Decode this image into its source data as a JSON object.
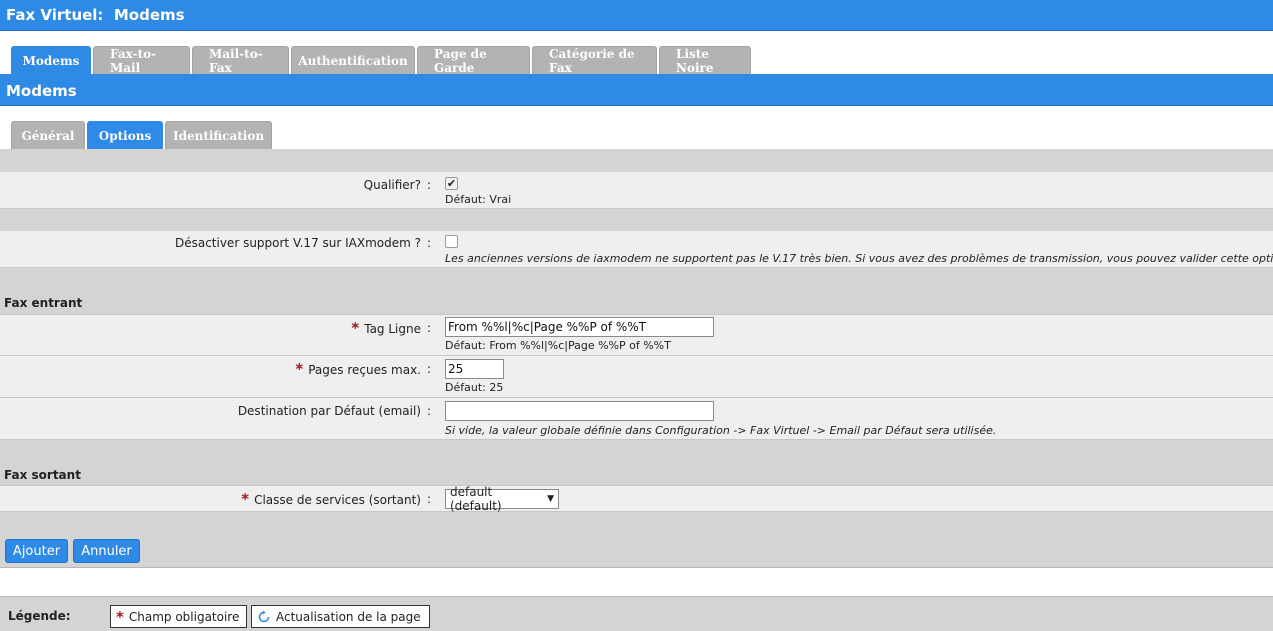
{
  "window": {
    "title": "Fax Virtuel:  Modems"
  },
  "main_tabs": [
    {
      "label": "Modems",
      "active": true
    },
    {
      "label": "Fax-to-Mail",
      "active": false
    },
    {
      "label": "Mail-to-Fax",
      "active": false
    },
    {
      "label": "Authentification",
      "active": false
    },
    {
      "label": "Page de Garde",
      "active": false
    },
    {
      "label": "Catégorie de Fax",
      "active": false
    },
    {
      "label": "Liste Noire",
      "active": false
    }
  ],
  "section": {
    "title": "Modems"
  },
  "sub_tabs": [
    {
      "label": "Général",
      "active": false
    },
    {
      "label": "Options",
      "active": true
    },
    {
      "label": "Identification",
      "active": false
    }
  ],
  "form": {
    "colon": ":",
    "qualifier": {
      "label": "Qualifier?",
      "checked": true,
      "hint": "Défaut: Vrai"
    },
    "v17": {
      "label": "Désactiver support V.17 sur IAXmodem ?",
      "checked": false,
      "hint": "Les anciennes versions de iaxmodem ne supportent pas le V.17 très bien. Si vous avez des problèmes de transmission, vous pouvez valider cette option."
    },
    "fax_in": {
      "title": "Fax entrant",
      "tag_ligne": {
        "label": "Tag Ligne",
        "value": "From %%l|%c|Page %%P of %%T",
        "hint": "Défaut: From %%l|%c|Page %%P of %%T"
      },
      "pages_max": {
        "label": "Pages reçues max.",
        "value": "25",
        "hint": "Défaut: 25"
      },
      "dest": {
        "label": "Destination par Défaut (email)",
        "value": "",
        "hint": "Si vide, la valeur globale définie dans Configuration -> Fax Virtuel -> Email par Défaut sera utilisée."
      }
    },
    "fax_out": {
      "title": "Fax sortant",
      "classe": {
        "label": "Classe de services (sortant)",
        "selected": "default (default)"
      }
    },
    "required_mark": "*"
  },
  "buttons": {
    "add": "Ajouter",
    "cancel": "Annuler"
  },
  "legend": {
    "label": "Légende:",
    "required": "Champ obligatoire",
    "refresh": "Actualisation de la page"
  },
  "colors": {
    "accent": "#2f8ae5",
    "required": "#a01919"
  }
}
